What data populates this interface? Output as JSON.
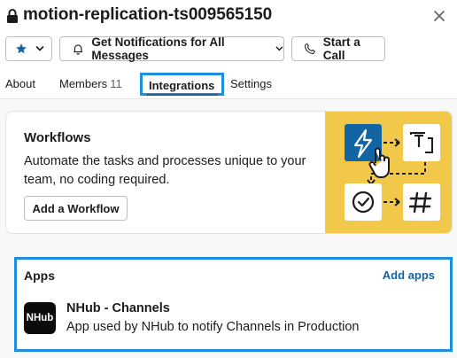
{
  "header": {
    "title": "motion-replication-ts009565150",
    "lock_icon": "lock-icon",
    "close_icon": "close-icon"
  },
  "actions": {
    "star_icon": "star-icon",
    "chevron_icon": "chevron-down-icon",
    "notifications_label": "Get Notifications for All Messages",
    "bell_icon": "bell-icon",
    "call_label": "Start a Call",
    "phone_icon": "phone-icon"
  },
  "tabs": {
    "about": "About",
    "members": "Members",
    "members_count": "11",
    "integrations": "Integrations",
    "settings": "Settings"
  },
  "workflows": {
    "title": "Workflows",
    "description": "Automate the tasks and processes unique to your team, no coding required.",
    "button_label": "Add a Workflow"
  },
  "apps": {
    "title": "Apps",
    "add_label": "Add apps",
    "items": [
      {
        "logo_text": "NHub",
        "name": "NHub - Channels",
        "description": "App used by NHub to notify Channels in Production"
      }
    ]
  },
  "colors": {
    "accent_blue": "#1264a3",
    "highlight_blue": "#1d8fe3",
    "illustration_yellow": "#f2c84b",
    "workflow_tile_blue": "#1264a3",
    "text": "#1d1c1d"
  }
}
